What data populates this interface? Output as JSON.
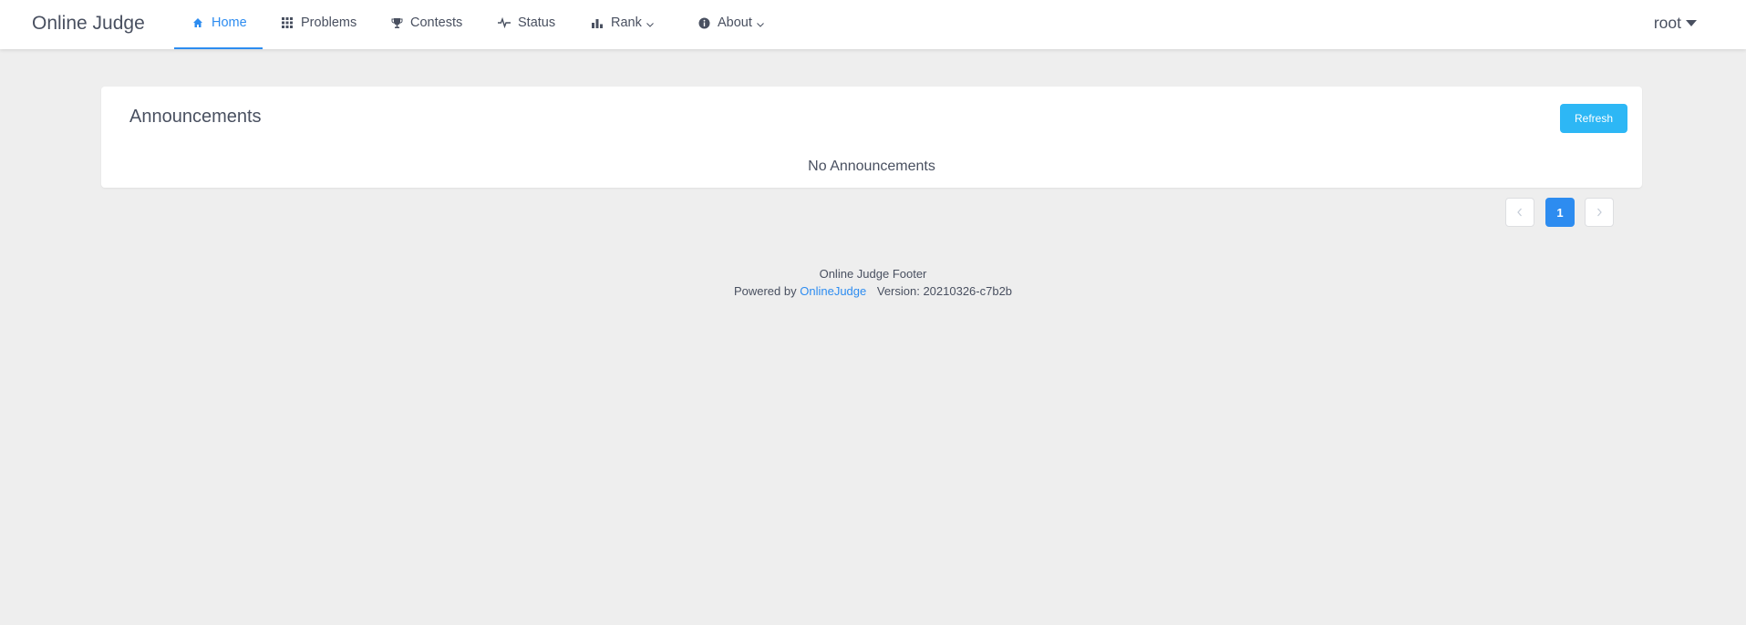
{
  "header": {
    "brand": "Online Judge",
    "nav": [
      {
        "label": "Home",
        "icon": "home-icon"
      },
      {
        "label": "Problems",
        "icon": "grid-icon"
      },
      {
        "label": "Contests",
        "icon": "trophy-icon"
      },
      {
        "label": "Status",
        "icon": "pulse-icon"
      },
      {
        "label": "Rank",
        "icon": "bar-chart-icon"
      },
      {
        "label": "About",
        "icon": "info-icon"
      }
    ],
    "user": "root"
  },
  "announcements": {
    "title": "Announcements",
    "refresh_label": "Refresh",
    "empty_text": "No Announcements"
  },
  "pagination": {
    "current_page": "1"
  },
  "footer": {
    "line1": "Online Judge Footer",
    "powered_by": "Powered by",
    "link_text": "OnlineJudge",
    "version": "Version: 20210326-c7b2b"
  },
  "colors": {
    "accent": "#2d8cf0",
    "refresh": "#2db7f5",
    "background": "#eeeeee"
  }
}
